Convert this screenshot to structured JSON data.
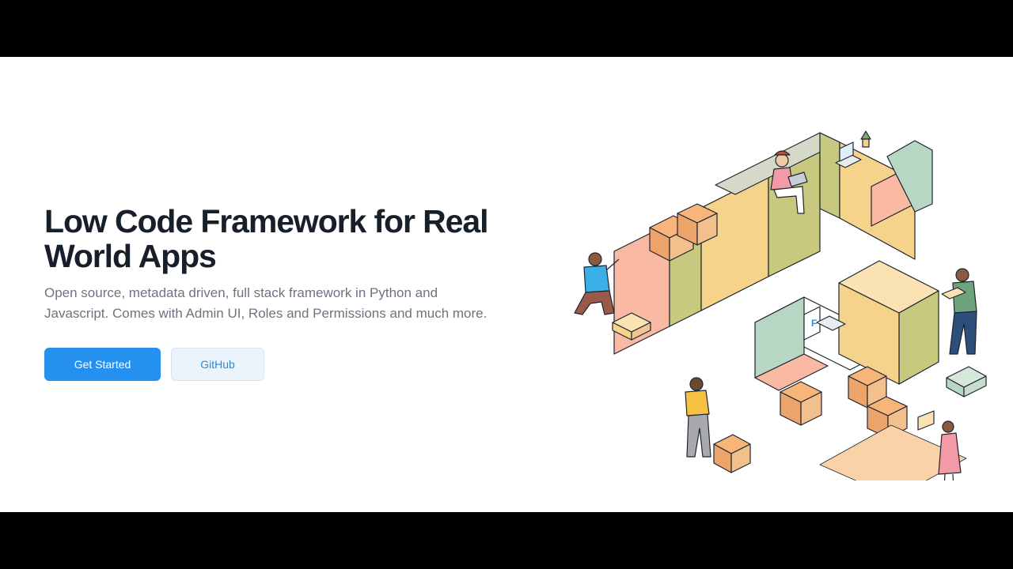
{
  "hero": {
    "title": "Low Code Framework for Real World Apps",
    "subtitle": "Open source, metadata driven, full stack framework in Python and Javascript. Comes with Admin UI, Roles and Permissions and much more.",
    "primary_button": "Get Started",
    "secondary_button": "GitHub"
  },
  "illustration": {
    "desc_icon": "isometric-warehouse-illustration",
    "logo_glyph": "F"
  },
  "colors": {
    "primary": "#2490ef",
    "title": "#171f2b",
    "subtitle": "#6b7480",
    "secondary_bg": "#ebf4fd"
  }
}
